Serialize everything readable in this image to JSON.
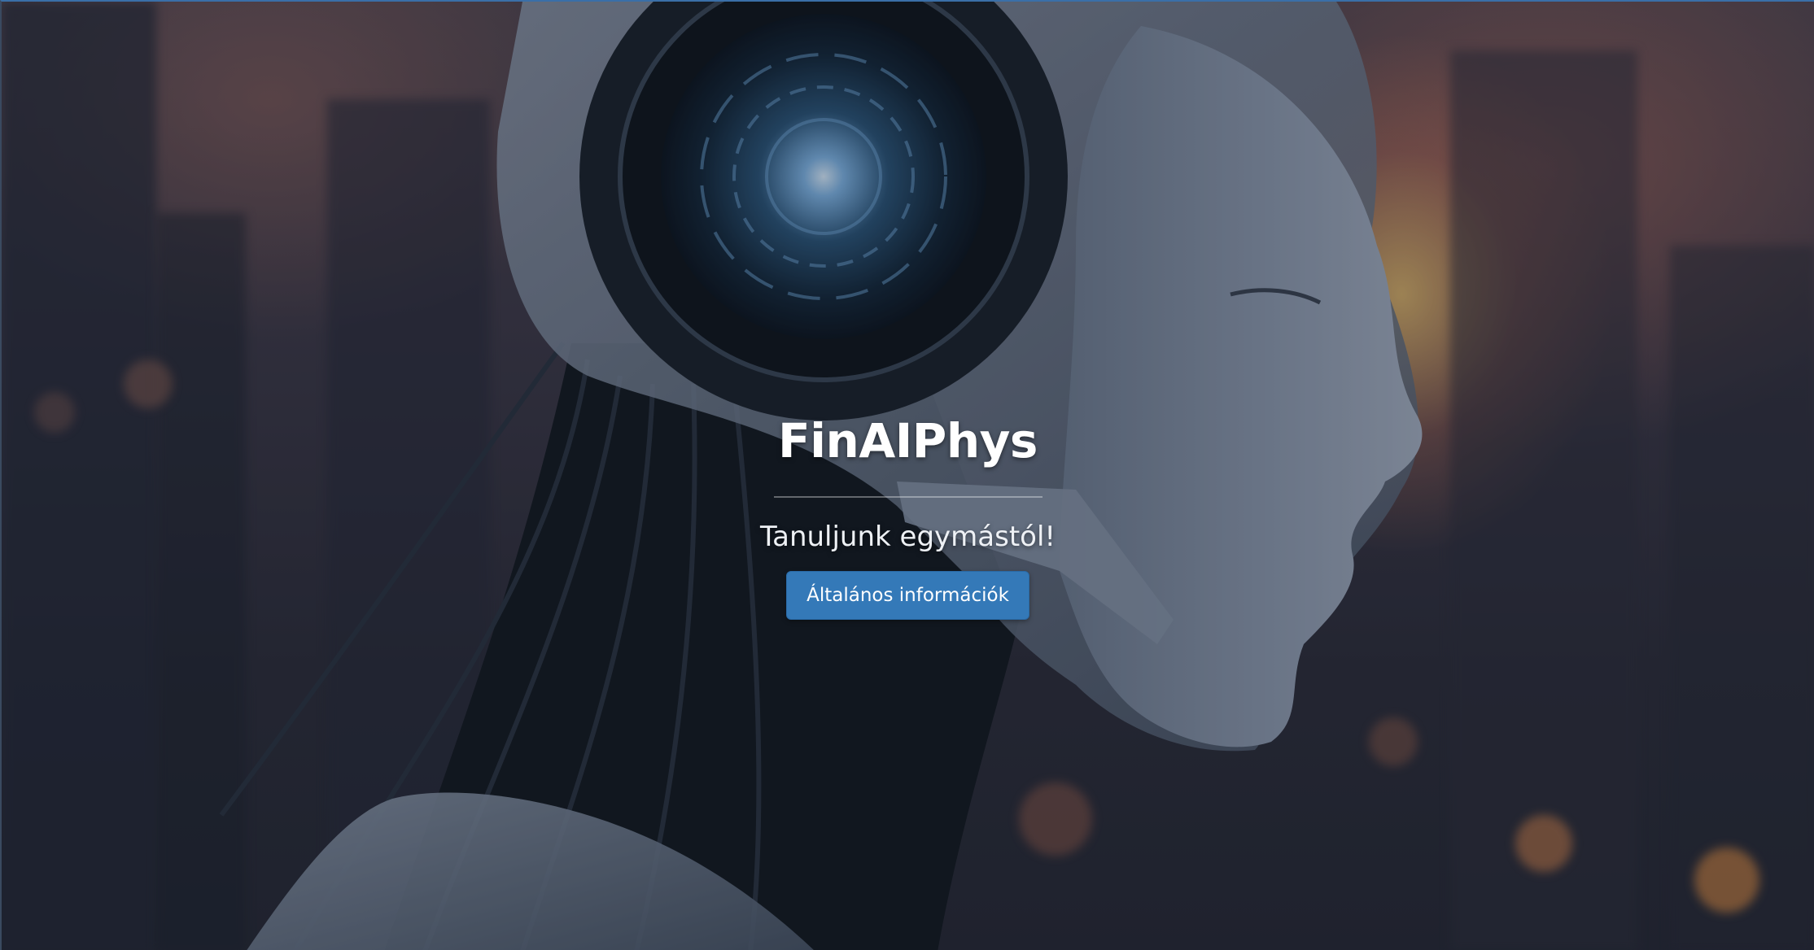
{
  "hero": {
    "title": "FinAIPhys",
    "subtitle": "Tanuljunk egymástól!",
    "cta_label": "Általános információk",
    "accent_color": "#3479b8",
    "background_image": "robot-woman-profile-city-sunset"
  }
}
